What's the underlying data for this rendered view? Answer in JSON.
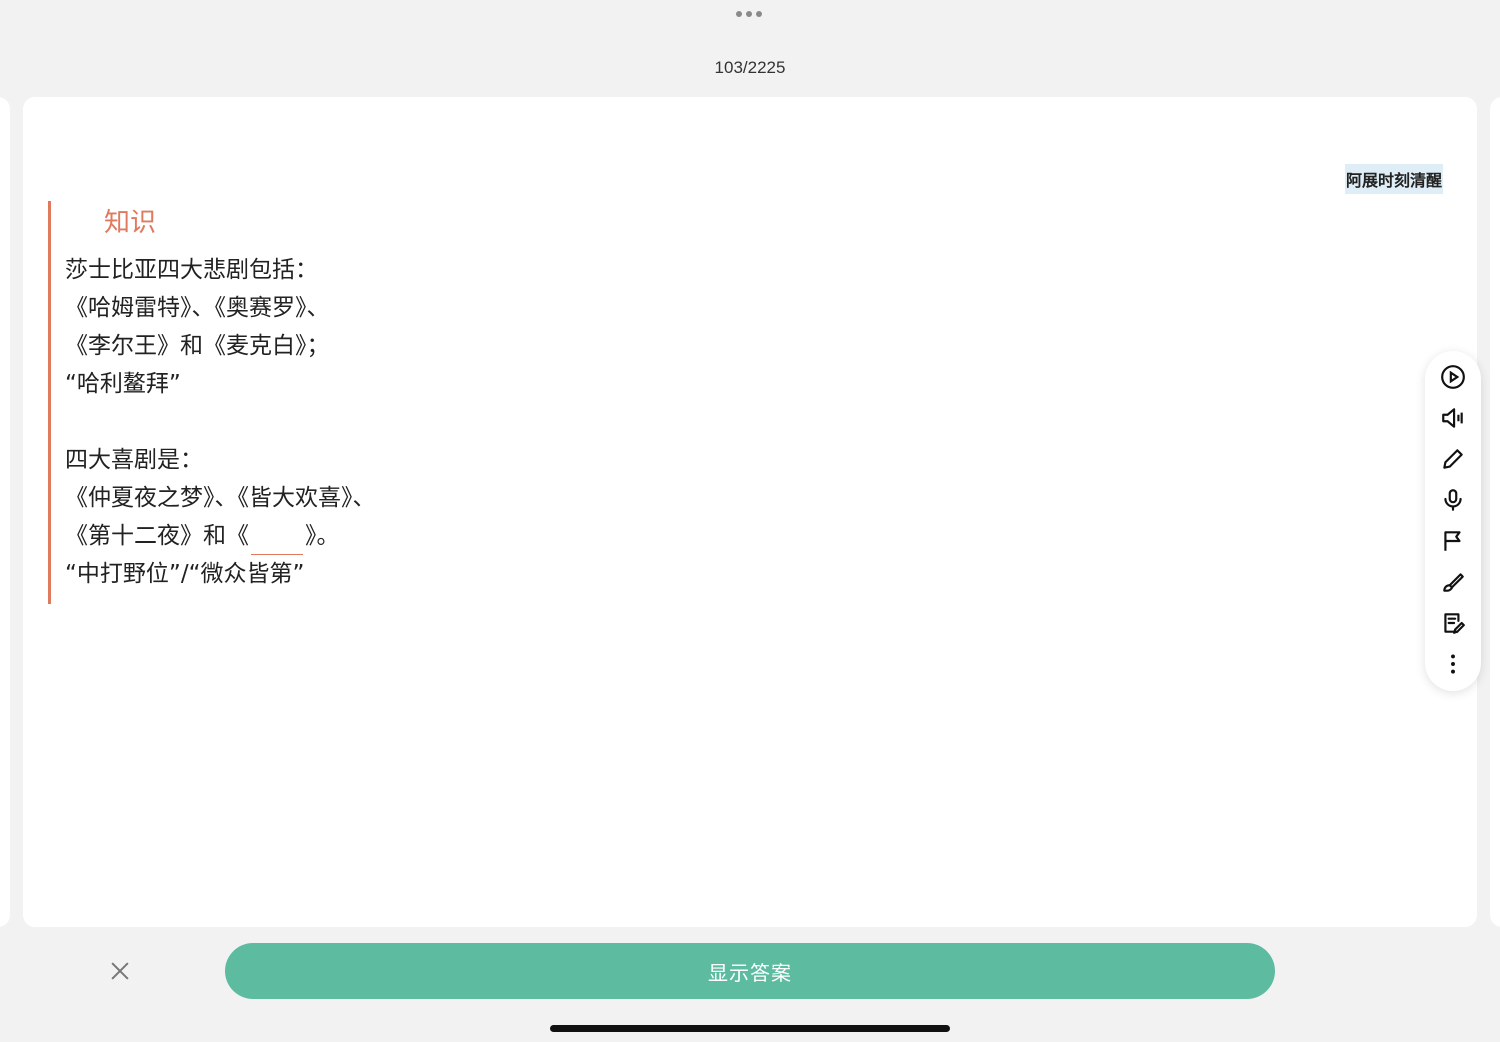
{
  "header": {
    "progress": "103/2225"
  },
  "card": {
    "tag": "阿展时刻清醒",
    "section_title": "知识",
    "lines": [
      "莎士比亚四大悲剧包括：",
      "《哈姆雷特》、《奥赛罗》、",
      "《李尔王》和《麦克白》；",
      "“哈利鳌拜”",
      "",
      "四大喜剧是：",
      "《仲夏夜之梦》、《皆大欢喜》、"
    ],
    "cloze_line_prefix": "《第十二夜》和《",
    "cloze_line_suffix": "》。",
    "last_line": "“中打野位”/“微众皆第”"
  },
  "toolbar": {
    "icons": [
      "play-icon",
      "speaker-icon",
      "pencil-icon",
      "microphone-icon",
      "flag-icon",
      "brush-icon",
      "note-edit-icon",
      "more-vertical-icon"
    ]
  },
  "footer": {
    "show_answer_label": "显示答案"
  },
  "colors": {
    "accent": "#e07a5f",
    "primary_button": "#5dbca0",
    "tag_bg": "#dfeef6"
  }
}
